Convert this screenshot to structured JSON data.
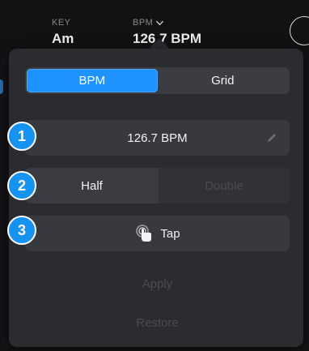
{
  "header": {
    "key_label": "KEY",
    "key_value": "Am",
    "bpm_label": "BPM",
    "bpm_value": "126.7 BPM"
  },
  "popover": {
    "tabs": [
      {
        "label": "BPM",
        "active": true
      },
      {
        "label": "Grid",
        "active": false
      }
    ],
    "bpm_field": {
      "value": "126.7 BPM",
      "icon": "pencil-icon"
    },
    "half_label": "Half",
    "double_label": "Double",
    "tap_label": "Tap",
    "tap_icon": "tap-finger-icon",
    "apply_label": "Apply",
    "restore_label": "Restore"
  },
  "badges": [
    "1",
    "2",
    "3"
  ],
  "colors": {
    "accent": "#1e93ff",
    "panel": "#2b2c30",
    "row": "#38393e",
    "disabled_text": "#4a4b50"
  }
}
